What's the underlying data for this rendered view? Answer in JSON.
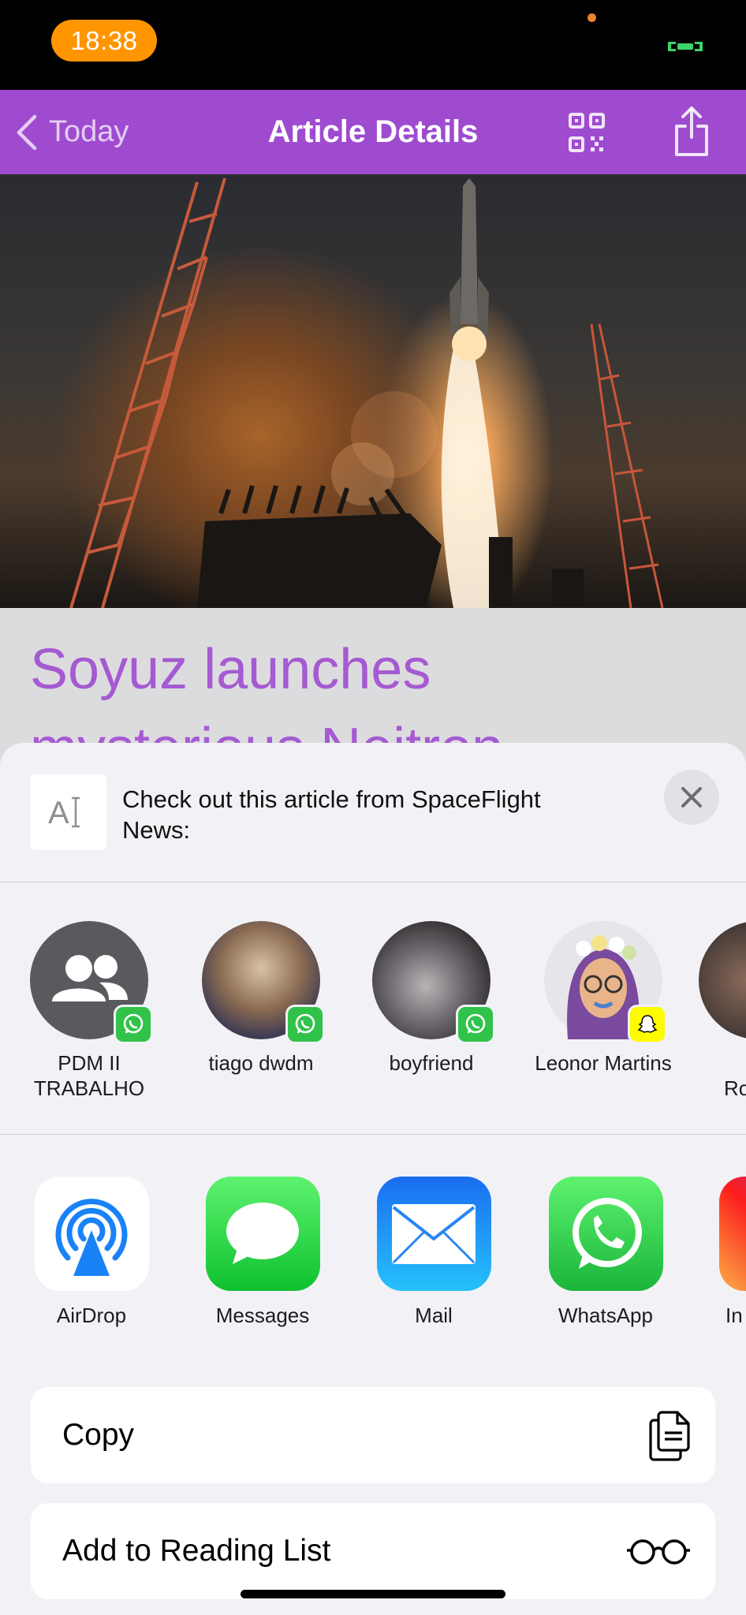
{
  "status_bar": {
    "time": "18:38"
  },
  "nav": {
    "back_label": "Today",
    "title": "Article Details"
  },
  "article": {
    "title": "Soyuz launches mysterious Neitron"
  },
  "share_sheet": {
    "text_preview_glyph": "A",
    "message": "Check out this article from SpaceFlight News:",
    "contacts": [
      {
        "name": "PDM II TRABALHO",
        "badge": "whatsapp"
      },
      {
        "name": "tiago dwdm",
        "badge": "whatsapp"
      },
      {
        "name": "boyfriend",
        "badge": "whatsapp"
      },
      {
        "name": "Leonor Martins",
        "badge": "snapchat"
      },
      {
        "name": "Ro",
        "badge": ""
      }
    ],
    "apps": [
      {
        "label": "AirDrop"
      },
      {
        "label": "Messages"
      },
      {
        "label": "Mail"
      },
      {
        "label": "WhatsApp"
      },
      {
        "label": "In"
      }
    ],
    "actions": [
      {
        "label": "Copy",
        "icon": "copy-icon"
      },
      {
        "label": "Add to Reading List",
        "icon": "glasses-icon"
      }
    ]
  },
  "colors": {
    "nav": "#9e4bd0",
    "title": "#a55ad2",
    "time_pill": "#ff9500",
    "whatsapp": "#31c24a",
    "snapchat": "#fffc00"
  }
}
